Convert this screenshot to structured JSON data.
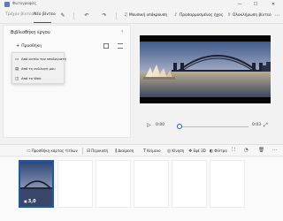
{
  "app": {
    "title": "Φωτογραφίες"
  },
  "window": {
    "minimize": "—",
    "maximize": "☐",
    "close": "✕"
  },
  "toolbar": {
    "tab_old": "Τρέχον βίντεο",
    "tab_new": "Νέο βίντεο",
    "edit_icon": "✎",
    "undo_icon": "↶",
    "redo_icon": "↷",
    "music_label": "Μουσική υπόκρουση",
    "custom_audio_label": "Προσαρμοσμένος ήχος",
    "finish_label": "Ολοκλήρωση βίντεο",
    "more_icon": "⋯"
  },
  "library": {
    "title": "Βιβλιοθήκη έργου",
    "collapse_icon": "‹",
    "add_label": "Προσθήκη",
    "add_icon": "+",
    "menu": [
      {
        "icon": "▭",
        "label": "Από αυτόν τον υπολογιστή"
      },
      {
        "icon": "▤",
        "label": "Από τη συλλογή μου"
      },
      {
        "icon": "◫",
        "label": "Από το Web"
      }
    ]
  },
  "player": {
    "play_icon": "▷",
    "current_time": "0:00",
    "duration": "0:03",
    "progress": 0.0,
    "expand_icon": "⤢"
  },
  "storyboard": {
    "add_title_card": "Προσθήκη κάρτας τίτλων",
    "trim": "Περικοπή",
    "split": "Διαίρεση",
    "text": "Κείμενο",
    "motion": "Κίνηση",
    "effects_3d": "Εφέ 3D",
    "filters": "Φίλτρα",
    "more_icon": "⋯",
    "clip_duration": "3,0",
    "clip_icon": "▣",
    "colors": {
      "accent": "#1a56b8"
    }
  }
}
